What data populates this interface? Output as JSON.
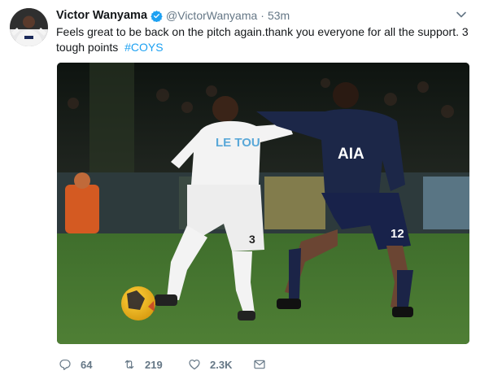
{
  "tweet": {
    "author_name": "Victor Wanyama",
    "handle": "@VictorWanyama",
    "separator": "·",
    "time": "53m",
    "text": "Feels great to be back on the pitch again.thank you everyone for all the support. 3 tough points",
    "hashtag": "#COYS"
  },
  "media": {
    "description": "photo",
    "shirt_sponsor_white": "LE TOU",
    "shirt_sponsor_navy": "AIA",
    "shirt_number_white": "3",
    "shirt_number_navy": "12"
  },
  "actions": {
    "reply_count": "64",
    "retweet_count": "219",
    "like_count": "2.3K"
  },
  "icons": {
    "verified": "verified-badge-icon",
    "caret": "chevron-down-icon",
    "reply": "reply-icon",
    "retweet": "retweet-icon",
    "like": "heart-icon",
    "dm": "envelope-icon"
  },
  "colors": {
    "accent": "#1da1f2",
    "muted": "#657786",
    "text": "#14171a"
  }
}
